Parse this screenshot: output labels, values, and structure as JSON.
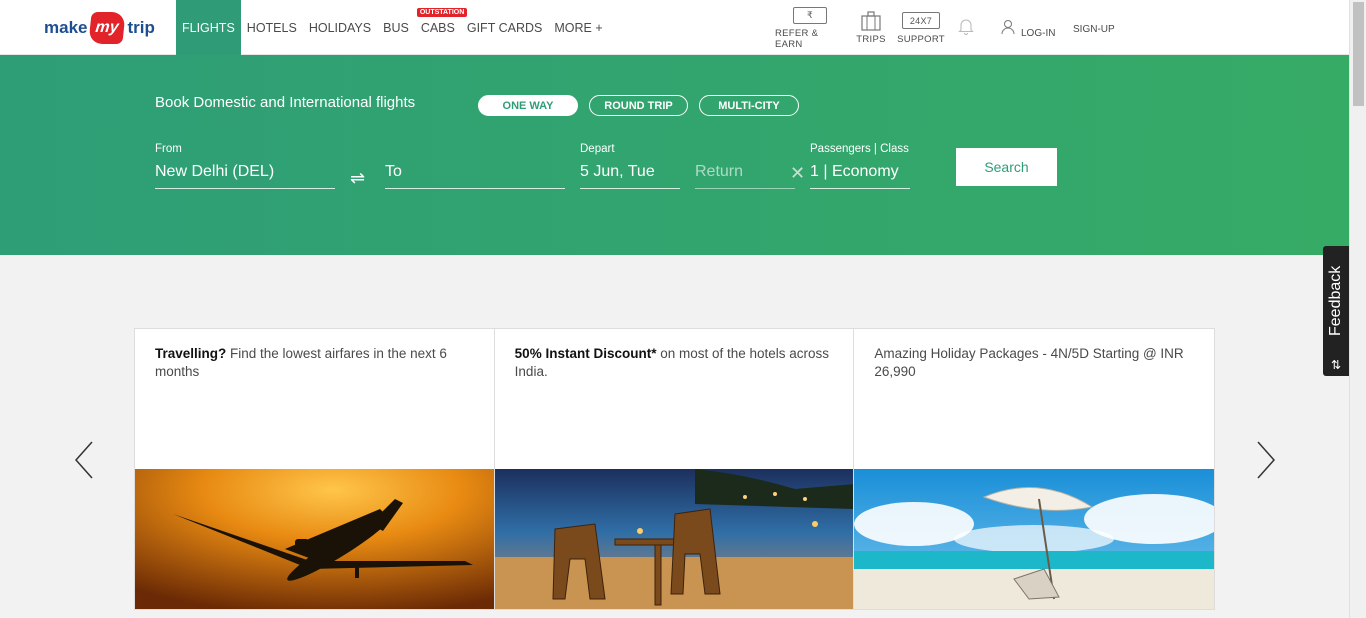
{
  "brand": {
    "part1": "make",
    "part2": "my",
    "part3": "trip"
  },
  "nav": [
    {
      "label": "FLIGHTS"
    },
    {
      "label": "HOTELS"
    },
    {
      "label": "HOLIDAYS"
    },
    {
      "label": "BUS"
    },
    {
      "label": "CABS",
      "tag": "OUTSTATION"
    },
    {
      "label": "GIFT CARDS"
    },
    {
      "label": "MORE +"
    }
  ],
  "header_right": {
    "refer": {
      "label": "REFER & EARN",
      "icon": "₹"
    },
    "trips": {
      "label": "TRIPS"
    },
    "support": {
      "label": "SUPPORT",
      "icon": "24X7"
    },
    "login": "LOG-IN",
    "signup": "SIGN-UP"
  },
  "hero": {
    "title": "Book Domestic and International flights",
    "trip_types": [
      "ONE WAY",
      "ROUND TRIP",
      "MULTI-CITY"
    ],
    "from": {
      "label": "From",
      "value": "New Delhi (DEL)"
    },
    "to": {
      "placeholder": "To"
    },
    "depart": {
      "label": "Depart",
      "value": "5 Jun, Tue"
    },
    "return": {
      "placeholder": "Return"
    },
    "passengers": {
      "label": "Passengers | Class",
      "value": "1 | Economy"
    },
    "search_label": "Search"
  },
  "offers": [
    {
      "bold": "Travelling?",
      "text": " Find the lowest airfares in the next 6 months"
    },
    {
      "bold": "50% Instant Discount*",
      "text": " on most of the hotels across India."
    },
    {
      "bold": "",
      "text": "Amazing Holiday Packages - 4N/5D Starting @ INR 26,990"
    }
  ],
  "feedback": {
    "label": "Feedback",
    "icon": "⇅"
  },
  "colors": {
    "brand_green": "#2e9e77",
    "brand_red": "#e2232a",
    "brand_blue": "#1d4f91"
  }
}
